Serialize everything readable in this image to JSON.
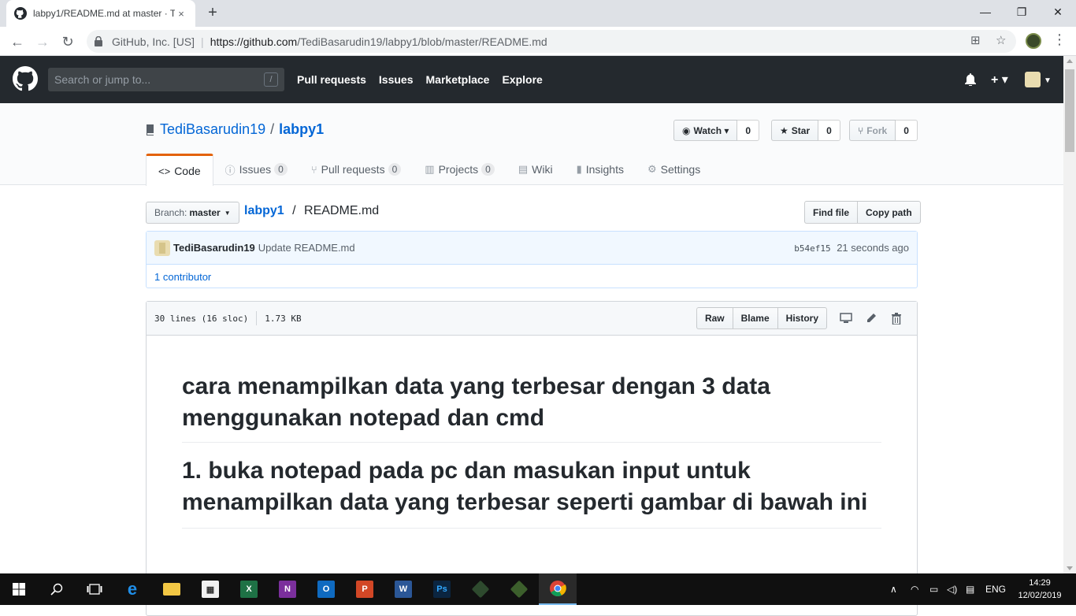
{
  "browser": {
    "tab_title": "labpy1/README.md at master · T",
    "tab_close": "×",
    "new_tab": "+",
    "site_identity": "GitHub, Inc. [US]",
    "url_host": "https://github.com",
    "url_path": "/TediBasarudin19/labpy1/blob/master/README.md",
    "window_controls": {
      "minimize": "—",
      "restore": "❐",
      "close": "✕"
    }
  },
  "github_header": {
    "search_placeholder": "Search or jump to...",
    "search_shortcut": "/",
    "nav": [
      "Pull requests",
      "Issues",
      "Marketplace",
      "Explore"
    ],
    "plus": "+ ▾"
  },
  "repo": {
    "owner": "TediBasarudin19",
    "separator": "/",
    "name": "labpy1",
    "watch_label": "Watch ▾",
    "watch_count": "0",
    "star_label": "Star",
    "star_count": "0",
    "fork_label": "Fork",
    "fork_count": "0",
    "tabs": [
      {
        "label": "Code",
        "icon": "<>"
      },
      {
        "label": "Issues",
        "icon": "ⓘ",
        "count": "0"
      },
      {
        "label": "Pull requests",
        "icon": "⑂",
        "count": "0"
      },
      {
        "label": "Projects",
        "icon": "▥",
        "count": "0"
      },
      {
        "label": "Wiki",
        "icon": "▤"
      },
      {
        "label": "Insights",
        "icon": "▮"
      },
      {
        "label": "Settings",
        "icon": "⚙"
      }
    ]
  },
  "file_nav": {
    "branch_label": "Branch:",
    "branch_value": "master",
    "breadcrumb_repo": "labpy1",
    "breadcrumb_sep": "/",
    "breadcrumb_file": "README.md",
    "find_file": "Find file",
    "copy_path": "Copy path"
  },
  "commit": {
    "author": "TediBasarudin19",
    "message": "Update README.md",
    "sha": "b54ef15",
    "time": "21 seconds ago",
    "contributors": "1 contributor"
  },
  "file": {
    "lines": "30 lines (16 sloc)",
    "size": "1.73 KB",
    "raw": "Raw",
    "blame": "Blame",
    "history": "History"
  },
  "readme": {
    "heading1": "cara menampilkan data yang terbesar dengan 3 data menggunakan notepad dan cmd",
    "heading2": "1. buka notepad pada pc dan masukan input untuk menampilkan data yang terbesar seperti gambar di bawah ini"
  },
  "taskbar": {
    "lang": "ENG",
    "time": "14:29",
    "date": "12/02/2019",
    "apps": [
      "start",
      "search",
      "task-view",
      "edge",
      "file-explorer",
      "store",
      "excel",
      "onenote",
      "outlook",
      "powerpoint",
      "word",
      "photoshop",
      "app-green-1",
      "app-green-2",
      "chrome"
    ]
  }
}
